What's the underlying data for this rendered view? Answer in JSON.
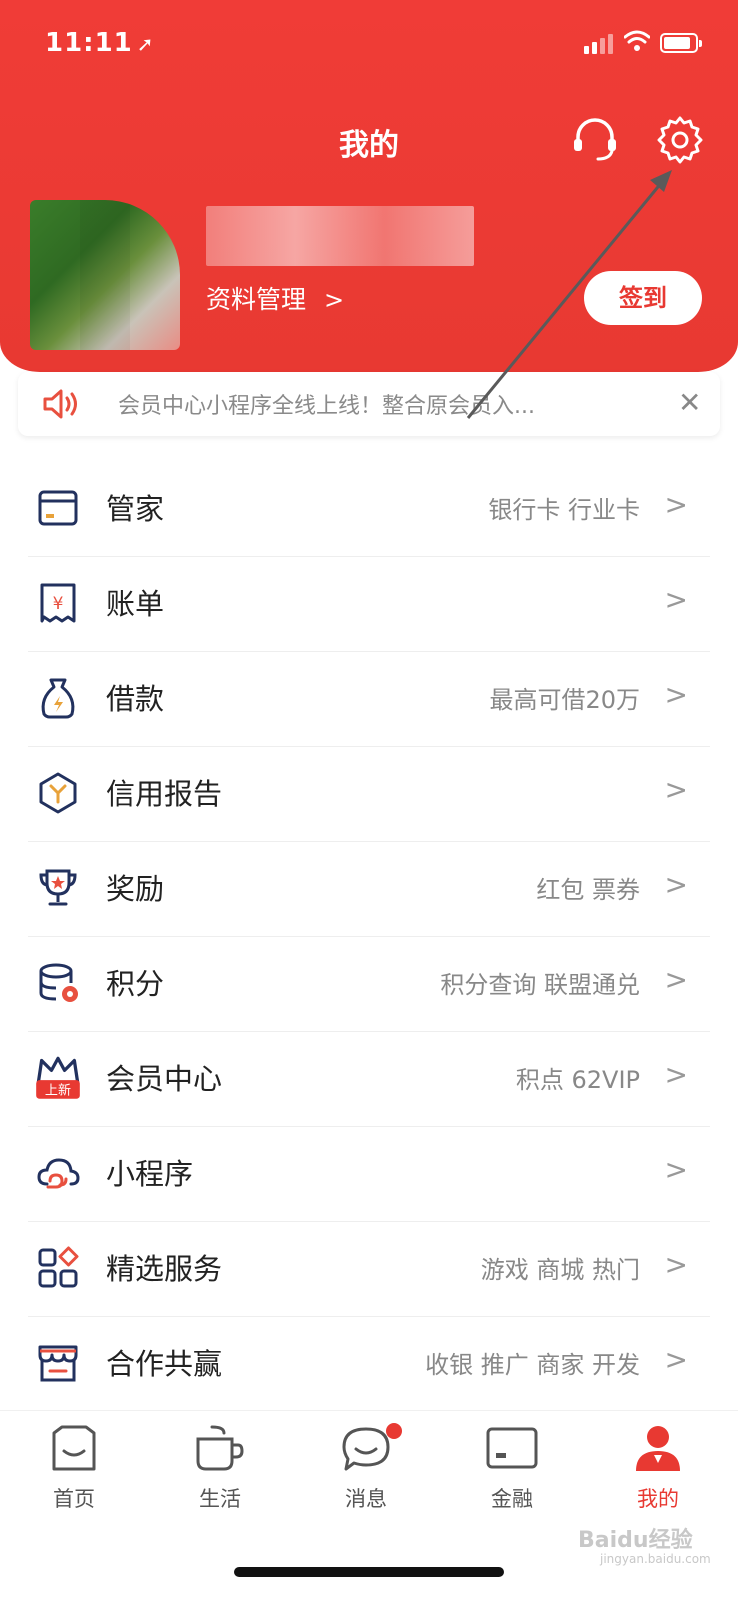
{
  "status_bar": {
    "time": "11:11",
    "time_arrow": "➚"
  },
  "header": {
    "title": "我的",
    "profile_link": "资料管理",
    "checkin": "签到",
    "accent_color": "#e83932"
  },
  "notice": {
    "text": "会员中心小程序全线上线！整合原会员入...",
    "close": "✕"
  },
  "menu": [
    {
      "label": "管家",
      "sub": "银行卡 行业卡",
      "icon": "card-icon"
    },
    {
      "label": "账单",
      "sub": "",
      "icon": "bill-icon"
    },
    {
      "label": "借款",
      "sub": "最高可借20万",
      "icon": "loan-bag-icon"
    },
    {
      "label": "信用报告",
      "sub": "",
      "icon": "credit-report-icon"
    },
    {
      "label": "奖励",
      "sub": "红包 票券",
      "icon": "trophy-icon"
    },
    {
      "label": "积分",
      "sub": "积分查询 联盟通兑",
      "icon": "points-icon"
    },
    {
      "label": "会员中心",
      "sub": "积点 62VIP",
      "icon": "crown-icon",
      "tag": "上新"
    },
    {
      "label": "小程序",
      "sub": "",
      "icon": "cloud-icon"
    },
    {
      "label": "精选服务",
      "sub": "游戏 商城 热门",
      "icon": "grid-icon"
    },
    {
      "label": "合作共赢",
      "sub": "收银 推广 商家 开发",
      "icon": "store-icon"
    }
  ],
  "tabs": [
    {
      "label": "首页",
      "icon": "home-icon"
    },
    {
      "label": "生活",
      "icon": "cup-icon"
    },
    {
      "label": "消息",
      "icon": "chat-icon"
    },
    {
      "label": "金融",
      "icon": "finance-card-icon"
    },
    {
      "label": "我的",
      "icon": "profile-icon"
    }
  ],
  "watermark": {
    "text": "Baidu经验",
    "sub": "jingyan.baidu.com"
  }
}
